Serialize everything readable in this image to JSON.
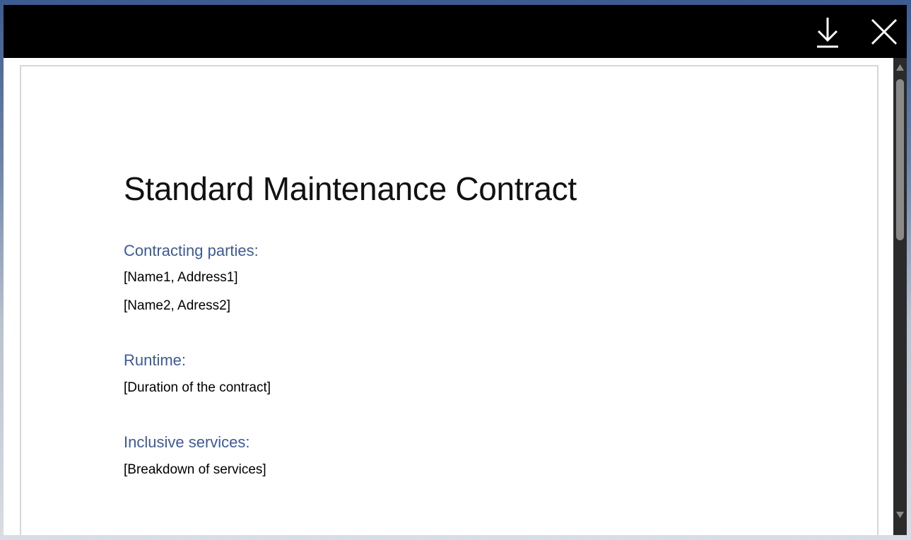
{
  "toolbar": {
    "download_icon": "download-icon",
    "close_icon": "close-icon"
  },
  "document": {
    "title": "Standard Maintenance Contract",
    "sections": [
      {
        "heading": "Contracting parties:",
        "lines": [
          "[Name1, Address1]",
          "[Name2, Adress2]"
        ]
      },
      {
        "heading": "Runtime:",
        "lines": [
          "[Duration of the contract]"
        ]
      },
      {
        "heading": "Inclusive services:",
        "lines": [
          "[Breakdown of services]"
        ]
      }
    ]
  },
  "colors": {
    "title_bar": "#000000",
    "heading": "#3d5a96",
    "scrollbar_track": "#2b2b2b",
    "scrollbar_thumb": "#8a8a8a"
  }
}
